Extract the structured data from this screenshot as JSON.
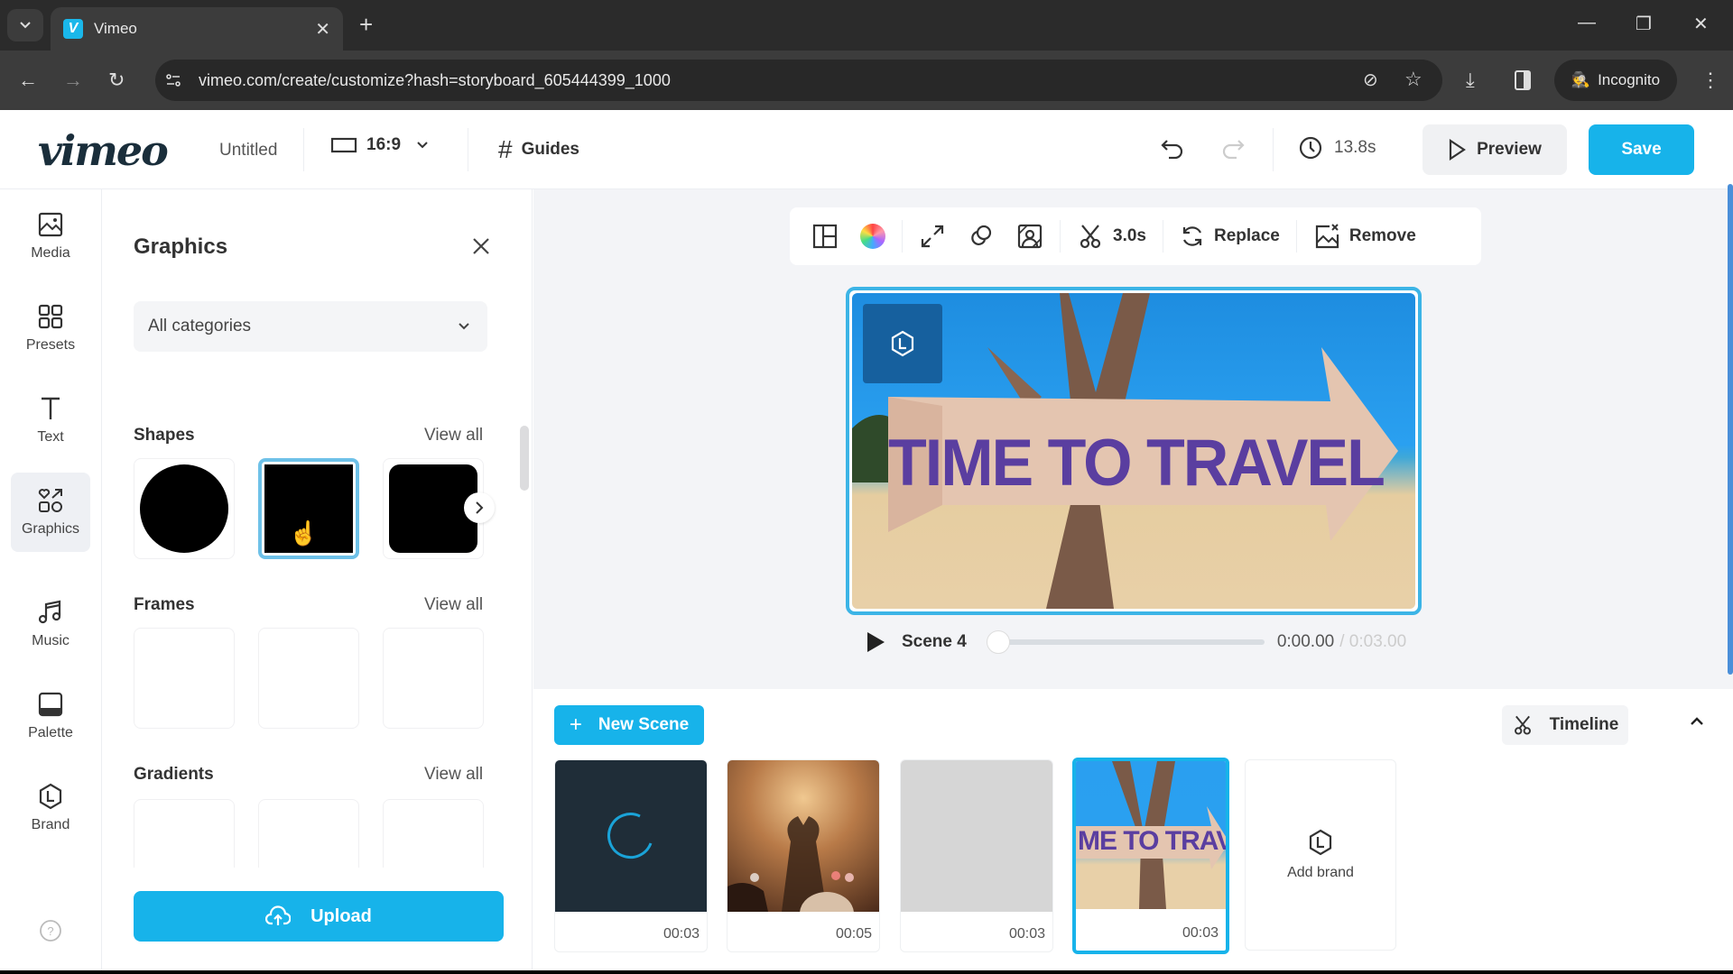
{
  "browser": {
    "tab_title": "Vimeo",
    "favicon_letter": "V",
    "url": "vimeo.com/create/customize?hash=storyboard_605444399_1000",
    "incognito_label": "Incognito"
  },
  "header": {
    "logo": "vimeo",
    "doc_title": "Untitled",
    "aspect_ratio": "16:9",
    "guides_label": "Guides",
    "total_duration": "13.8s",
    "preview_label": "Preview",
    "save_label": "Save",
    "accent_color": "#17b3ea"
  },
  "sidebar": {
    "items": [
      {
        "label": "Media",
        "icon": "image-icon"
      },
      {
        "label": "Presets",
        "icon": "grid-icon"
      },
      {
        "label": "Text",
        "icon": "text-icon"
      },
      {
        "label": "Graphics",
        "icon": "graphics-icon",
        "active": true
      },
      {
        "label": "Music",
        "icon": "music-icon"
      },
      {
        "label": "Palette",
        "icon": "palette-icon"
      },
      {
        "label": "Brand",
        "icon": "brand-icon"
      }
    ],
    "help_icon": "help-icon"
  },
  "panel": {
    "title": "Graphics",
    "category_select": "All categories",
    "sections": [
      {
        "title": "Shapes",
        "view_all": "View all",
        "items": [
          "circle",
          "square",
          "rounded-notched-rectangle"
        ],
        "selected_index": 1
      },
      {
        "title": "Frames",
        "view_all": "View all"
      },
      {
        "title": "Gradients",
        "view_all": "View all"
      }
    ],
    "upload_label": "Upload"
  },
  "element_toolbar": {
    "trim_duration": "3.0s",
    "replace_label": "Replace",
    "remove_label": "Remove"
  },
  "canvas": {
    "text": "TIME TO TRAVEL"
  },
  "player": {
    "scene_label": "Scene 4",
    "current_time": "0:00.00",
    "total_time": "/ 0:03.00",
    "progress": 0
  },
  "storyboard": {
    "new_scene_label": "New Scene",
    "timeline_label": "Timeline",
    "scenes": [
      {
        "duration": "00:03",
        "type": "loading"
      },
      {
        "duration": "00:05",
        "type": "concert-heart-hands"
      },
      {
        "duration": "00:03",
        "type": "blank"
      },
      {
        "duration": "00:03",
        "type": "time-to-travel",
        "thumb_text": "ME TO TRAVEL",
        "selected": true
      }
    ],
    "add_brand_label": "Add brand"
  }
}
